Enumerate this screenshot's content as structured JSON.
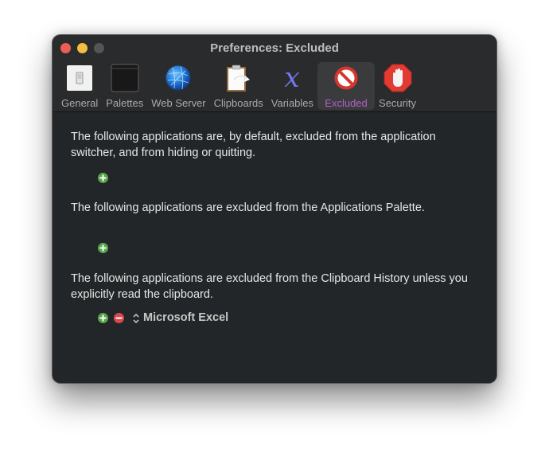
{
  "window": {
    "title": "Preferences: Excluded"
  },
  "toolbar": {
    "items": [
      {
        "label": "General",
        "icon": "general-switch-icon",
        "selected": false
      },
      {
        "label": "Palettes",
        "icon": "palettes-icon",
        "selected": false
      },
      {
        "label": "Web Server",
        "icon": "globe-icon",
        "selected": false
      },
      {
        "label": "Clipboards",
        "icon": "clipboard-icon",
        "selected": false
      },
      {
        "label": "Variables",
        "icon": "variable-x-icon",
        "selected": false
      },
      {
        "label": "Excluded",
        "icon": "prohibited-icon",
        "selected": true
      },
      {
        "label": "Security",
        "icon": "stop-hand-icon",
        "selected": false
      }
    ],
    "selected_color": "#b45fc8"
  },
  "sections": [
    {
      "text": "The following applications are, by default, excluded from the application switcher, and from hiding or quitting.",
      "apps": []
    },
    {
      "text": "The following applications are excluded from the Applications Palette.",
      "apps": []
    },
    {
      "text": "The following applications are excluded from the Clipboard History unless you explicitly read the clipboard.",
      "apps": [
        "Microsoft Excel"
      ]
    }
  ],
  "colors": {
    "add": "#55a548",
    "remove": "#d9484e"
  }
}
